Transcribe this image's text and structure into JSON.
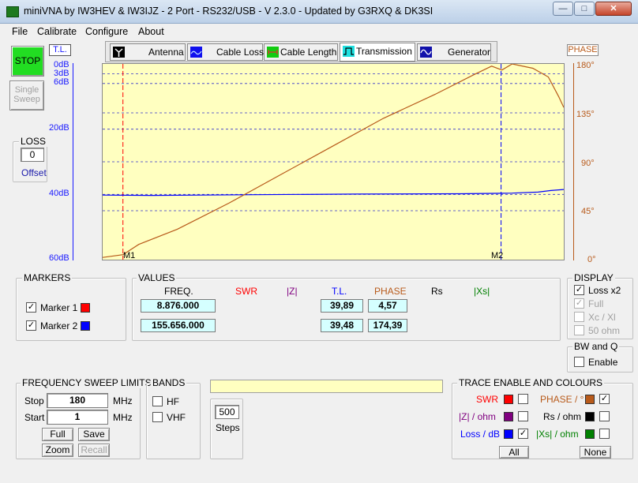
{
  "window": {
    "title": "miniVNA by IW3HEV & IW3IJZ - 2 Port - RS232/USB - V 2.3.0 - Updated by G3RXQ & DK3SI",
    "min": "—",
    "max": "□",
    "close": "✕"
  },
  "menu": [
    "File",
    "Calibrate",
    "Configure",
    "About"
  ],
  "left": {
    "stop": "STOP",
    "single_sweep": "Single Sweep",
    "loss_title": "LOSS",
    "loss_value": "0",
    "offset": "Offset"
  },
  "tabs": [
    {
      "label": "Antenna"
    },
    {
      "label": "Cable Loss"
    },
    {
      "label": "Cable Length"
    },
    {
      "label": "Transmission"
    },
    {
      "label": "Generator"
    }
  ],
  "chart": {
    "left_axis_title": "T.L.",
    "right_axis_title": "PHASE",
    "left_ticks": [
      "0dB",
      "3dB",
      "6dB",
      "20dB",
      "40dB",
      "60dB"
    ],
    "right_ticks": [
      "180°",
      "135°",
      "90°",
      "45°",
      "0°"
    ],
    "marker1_label": "M1",
    "marker2_label": "M2",
    "colors": {
      "tl": "#0000ff",
      "phase": "#b85a1a",
      "m1": "#ff0000",
      "m2": "#0000ff",
      "bg": "#ffffc0"
    }
  },
  "chart_data": {
    "type": "line",
    "yaxis_left": {
      "label": "T.L.",
      "ticks": [
        "0dB",
        "3dB",
        "6dB",
        "20dB",
        "40dB",
        "60dB"
      ],
      "ylim": [
        60,
        0
      ]
    },
    "yaxis_right": {
      "label": "PHASE",
      "ticks": [
        "180°",
        "135°",
        "90°",
        "45°",
        "0°"
      ],
      "ylim": [
        0,
        180
      ]
    },
    "xlim": [
      1,
      180
    ],
    "series": [
      {
        "name": "T.L.",
        "axis": "left",
        "points": [
          [
            1,
            40.2
          ],
          [
            20,
            40.3
          ],
          [
            60,
            40.1
          ],
          [
            100,
            39.9
          ],
          [
            140,
            39.8
          ],
          [
            160,
            39.6
          ],
          [
            170,
            39.3
          ],
          [
            175,
            38.8
          ],
          [
            180,
            38.5
          ]
        ]
      },
      {
        "name": "PHASE",
        "axis": "right",
        "points": [
          [
            1,
            2
          ],
          [
            8.876,
            4.57
          ],
          [
            15,
            14
          ],
          [
            30,
            28
          ],
          [
            50,
            52
          ],
          [
            70,
            78
          ],
          [
            90,
            104
          ],
          [
            110,
            130
          ],
          [
            130,
            152
          ],
          [
            145,
            170
          ],
          [
            152,
            178
          ],
          [
            156,
            174.39
          ],
          [
            160,
            180
          ],
          [
            168,
            176
          ],
          [
            174,
            168
          ],
          [
            178,
            150
          ],
          [
            180,
            140
          ]
        ]
      }
    ],
    "markers": [
      {
        "name": "M1",
        "x": 8.876
      },
      {
        "name": "M2",
        "x": 155.656
      }
    ]
  },
  "markers_panel": {
    "title": "MARKERS",
    "m1": "Marker 1",
    "m2": "Marker 2"
  },
  "values": {
    "title": "VALUES",
    "headers": [
      "FREQ.",
      "SWR",
      "|Z|",
      "T.L.",
      "PHASE",
      "Rs",
      "|Xs|"
    ],
    "rows": [
      {
        "freq": "8.876.000",
        "tl": "39,89",
        "phase": "4,57"
      },
      {
        "freq": "155.656.000",
        "tl": "39,48",
        "phase": "174,39"
      }
    ]
  },
  "display": {
    "title": "DISPLAY",
    "loss_x2": "Loss x2",
    "full": "Full",
    "xc_xl": "Xc / Xl",
    "ohm50": "50 ohm",
    "bwq_title": "BW and Q",
    "enable": "Enable"
  },
  "sweep": {
    "title": "FREQUENCY SWEEP LIMITS",
    "stop_label": "Stop",
    "stop_value": "180",
    "start_label": "Start",
    "start_value": "1",
    "unit": "MHz",
    "full": "Full",
    "save": "Save",
    "zoom": "Zoom",
    "recall": "Recall"
  },
  "bands": {
    "title": "BANDS",
    "hf": "HF",
    "vhf": "VHF"
  },
  "steps": {
    "value": "500",
    "label": "Steps"
  },
  "trace": {
    "title": "TRACE ENABLE AND COLOURS",
    "swr": "SWR",
    "z": "|Z| / ohm",
    "loss": "Loss / dB",
    "phase": "PHASE / °",
    "rs": "Rs / ohm",
    "xs": "|Xs| / ohm",
    "all": "All",
    "none": "None",
    "colors": {
      "swr": "#ff0000",
      "z": "#800080",
      "loss": "#0000ff",
      "phase": "#b85a1a",
      "rs": "#000000",
      "xs": "#008000"
    }
  }
}
